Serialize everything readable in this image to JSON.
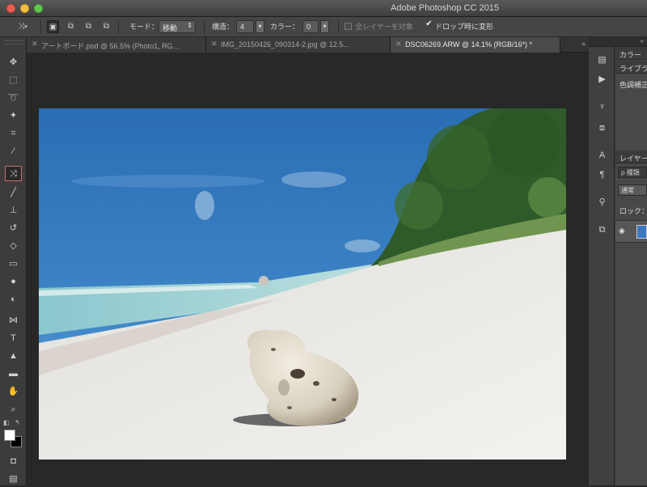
{
  "window": {
    "title": "Adobe Photoshop CC 2015"
  },
  "options": {
    "mode_label": "モード：",
    "mode_value": "移動",
    "structure_label": "構造：",
    "structure_value": "4",
    "color_label": "カラー：",
    "color_value": "0",
    "sample_all_label": "全レイヤーを対象",
    "transform_on_drop_label": "ドロップ時に変形",
    "transform_on_drop_checked": true
  },
  "tabs": [
    {
      "label": "アートボード.psd @ 56.5% (Photo1, RG..."
    },
    {
      "label": "IMG_20150426_090314-2.jpg @ 12.5..."
    },
    {
      "label": "DSC06269.ARW @ 14.1% (RGB/16*) *",
      "active": true
    }
  ],
  "tools": [
    {
      "name": "move-tool",
      "glyph": "✥"
    },
    {
      "name": "marquee-tool",
      "glyph": "⬚"
    },
    {
      "name": "lasso-tool",
      "glyph": "➰"
    },
    {
      "name": "magic-wand-tool",
      "glyph": "✦"
    },
    {
      "name": "crop-tool",
      "glyph": "⌗"
    },
    {
      "name": "eyedropper-tool",
      "glyph": "⁄"
    },
    {
      "name": "content-aware-move-tool",
      "glyph": "⤨",
      "active": true
    },
    {
      "name": "brush-tool",
      "glyph": "╱"
    },
    {
      "name": "stamp-tool",
      "glyph": "⊥"
    },
    {
      "name": "history-brush-tool",
      "glyph": "↺"
    },
    {
      "name": "eraser-tool",
      "glyph": "◇"
    },
    {
      "name": "gradient-tool",
      "glyph": "▭"
    },
    {
      "name": "blur-tool",
      "glyph": "●"
    },
    {
      "name": "dodge-tool",
      "glyph": "◐"
    },
    {
      "name": "pen-tool",
      "glyph": "⋈"
    },
    {
      "name": "type-tool",
      "glyph": "T"
    },
    {
      "name": "path-selection-tool",
      "glyph": "▲"
    },
    {
      "name": "rectangle-tool",
      "glyph": "▬"
    },
    {
      "name": "hand-tool",
      "glyph": "✋"
    },
    {
      "name": "zoom-tool",
      "glyph": "⌕"
    }
  ],
  "right_panels": {
    "color_tab": "カラー",
    "library_tab": "ライブラ",
    "color_sub": "色調補正",
    "layers_tab": "レイヤー",
    "search_placeholder": "ρ 種類",
    "blend_mode": "通常",
    "lock_label": "ロック："
  },
  "colors": {
    "foreground": "#ffffff",
    "background": "#000000",
    "accent_active_tool": "#c86f6f"
  }
}
